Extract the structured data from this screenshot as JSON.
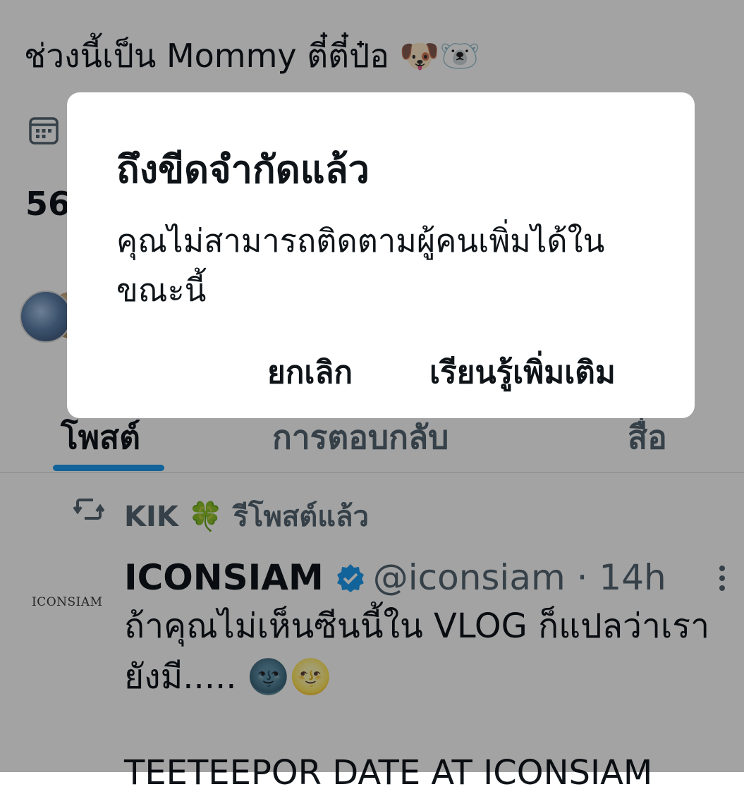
{
  "profile": {
    "bio": "ช่วงนี้เป็น Mommy ตี๋ตี๋ป๋อ 🐶🐻‍❄️",
    "count_fragment": "56"
  },
  "tabs": [
    {
      "label": "โพสต์"
    },
    {
      "label": "การตอบกลับ"
    },
    {
      "label": "สื่อ"
    }
  ],
  "timeline": {
    "repost_text": "KIK 🍀 รีโพสต์แล้ว",
    "tweet": {
      "avatar_logo": "ICONSIAM",
      "name": "ICONSIAM",
      "handle": "@iconsiam",
      "separator": "·",
      "time": "14h",
      "text": "ถ้าคุณไม่เห็นซีนนี้ใน VLOG ก็แปลว่าเรายังมี..... 🌚🌝",
      "text_second": "TEETEEPOR DATE AT ICONSIAM"
    }
  },
  "dialog": {
    "title": "ถึงขีดจำกัดแล้ว",
    "message": "คุณไม่สามารถติดตามผู้คนเพิ่มได้ในขณะนี้",
    "cancel_label": "ยกเลิก",
    "learn_more_label": "เรียนรู้เพิ่มเติม"
  },
  "colors": {
    "accent": "#1d9bf0",
    "text_primary": "#0f1419",
    "text_secondary": "#536471",
    "overlay": "rgba(0,0,0,0.36)"
  },
  "icons": [
    "calendar-icon",
    "repost-icon",
    "verified-badge-icon",
    "more-icon"
  ]
}
